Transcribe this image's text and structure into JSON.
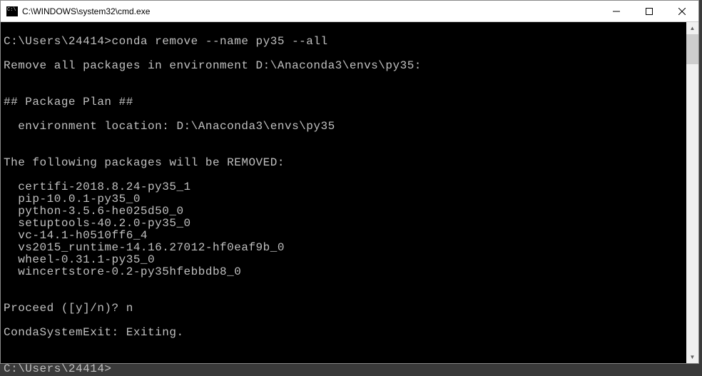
{
  "window": {
    "title": "C:\\WINDOWS\\system32\\cmd.exe"
  },
  "terminal": {
    "lines": [
      "",
      "C:\\Users\\24414>conda remove --name py35 --all",
      "",
      "Remove all packages in environment D:\\Anaconda3\\envs\\py35:",
      "",
      "",
      "## Package Plan ##",
      "",
      "  environment location: D:\\Anaconda3\\envs\\py35",
      "",
      "",
      "The following packages will be REMOVED:",
      "",
      "  certifi-2018.8.24-py35_1",
      "  pip-10.0.1-py35_0",
      "  python-3.5.6-he025d50_0",
      "  setuptools-40.2.0-py35_0",
      "  vc-14.1-h0510ff6_4",
      "  vs2015_runtime-14.16.27012-hf0eaf9b_0",
      "  wheel-0.31.1-py35_0",
      "  wincertstore-0.2-py35hfebbdb8_0",
      "",
      "",
      "Proceed ([y]/n)? n",
      "",
      "CondaSystemExit: Exiting.",
      "",
      "",
      "C:\\Users\\24414>"
    ]
  }
}
